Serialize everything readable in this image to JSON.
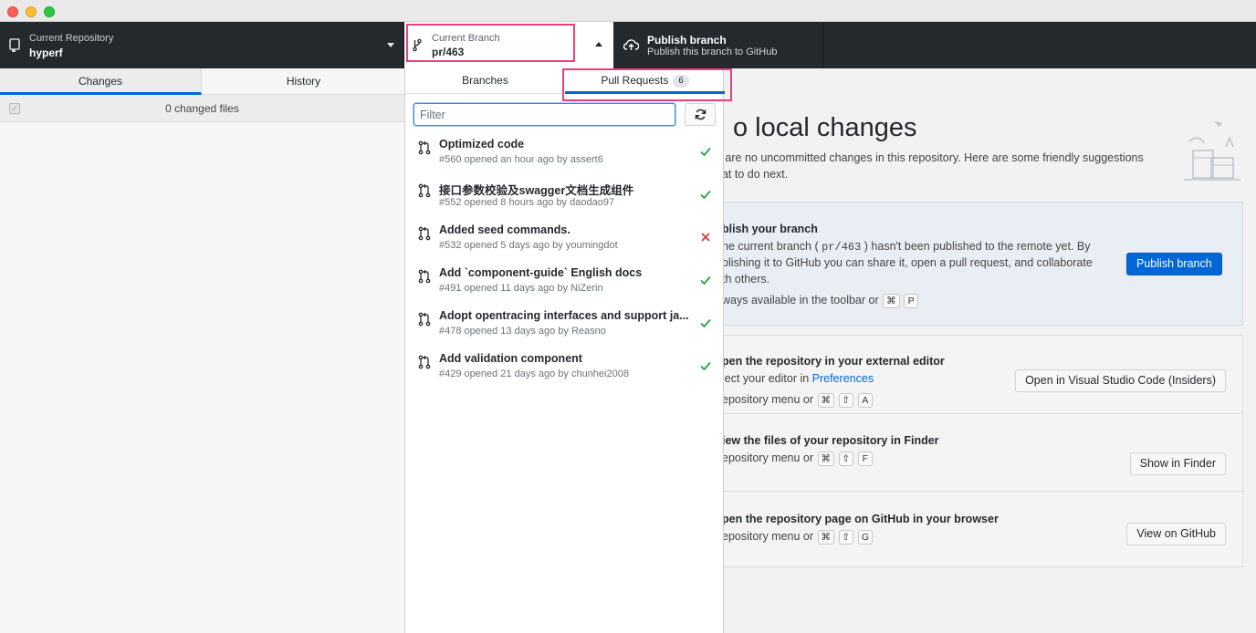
{
  "toolbar": {
    "repo_label": "Current Repository",
    "repo_name": "hyperf",
    "branch_label": "Current Branch",
    "branch_name": "pr/463",
    "publish_title": "Publish branch",
    "publish_subtitle": "Publish this branch to GitHub"
  },
  "left_panel": {
    "tabs": [
      "Changes",
      "History"
    ],
    "changed_files": "0 changed files"
  },
  "dropdown": {
    "tabs": {
      "branches": "Branches",
      "pull_requests": "Pull Requests",
      "pr_count": "6"
    },
    "filter_placeholder": "Filter",
    "pull_requests": [
      {
        "title": "Optimized code",
        "subtitle": "#560 opened an hour ago by assert6",
        "status": "success"
      },
      {
        "title": "接口参数校验及swagger文档生成组件",
        "subtitle": "#552 opened 8 hours ago by daodao97",
        "status": "success"
      },
      {
        "title": "Added seed commands.",
        "subtitle": "#532 opened 5 days ago by youmingdot",
        "status": "failure"
      },
      {
        "title": "Add `component-guide` English docs",
        "subtitle": "#491 opened 11 days ago by NiZerin",
        "status": "success"
      },
      {
        "title": "Adopt opentracing interfaces and support ja...",
        "subtitle": "#478 opened 13 days ago by Reasno",
        "status": "success"
      },
      {
        "title": "Add validation component",
        "subtitle": "#429 opened 21 days ago by chunhei2008",
        "status": "success"
      }
    ]
  },
  "main": {
    "title": "o local changes",
    "desc_line1": "e are no uncommitted changes in this repository. Here are some friendly suggestions",
    "desc_line2": "hat to do next.",
    "publish_card": {
      "title": "blish your branch",
      "line1_a": "he current branch (",
      "line1_code": "pr/463",
      "line1_b": ") hasn't been published to the remote yet. By",
      "line2": "blishing it to GitHub you can share it, open a pull request, and collaborate",
      "line3": "th others.",
      "hint": "ways available in the toolbar or",
      "keys": [
        "⌘",
        "P"
      ],
      "button": "Publish branch"
    },
    "editor_card": {
      "title": "pen the repository in your external editor",
      "text_a": "lect your editor in",
      "link": "Preferences",
      "hint": "epository menu or",
      "keys": [
        "⌘",
        "⇧",
        "A"
      ],
      "button": "Open in Visual Studio Code (Insiders)"
    },
    "finder_card": {
      "title": "iew the files of your repository in Finder",
      "hint": "epository menu or",
      "keys": [
        "⌘",
        "⇧",
        "F"
      ],
      "button": "Show in Finder"
    },
    "github_card": {
      "title": "pen the repository page on GitHub in your browser",
      "hint": "epository menu or",
      "keys": [
        "⌘",
        "⇧",
        "G"
      ],
      "button": "View on GitHub"
    }
  },
  "colors": {
    "accent": "#0366d6",
    "highlight": "#e8407e",
    "success": "#28a745",
    "failure": "#d73a49",
    "toolbar": "#24292e"
  }
}
